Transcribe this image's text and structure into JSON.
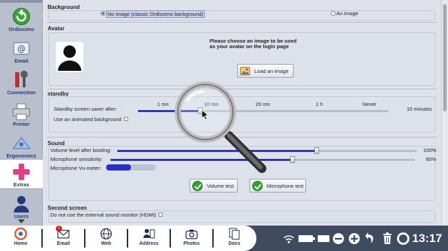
{
  "sidebar": {
    "items": [
      {
        "label": "Ordissimo",
        "icon": "back-arrow-icon"
      },
      {
        "label": "Email",
        "icon": "email-icon"
      },
      {
        "label": "Connection",
        "icon": "connection-tools-icon"
      },
      {
        "label": "Printer",
        "icon": "printer-icon"
      },
      {
        "label": "Ergonomics",
        "icon": "ergonomics-icon"
      },
      {
        "label": "Extras",
        "icon": "plus-icon"
      },
      {
        "label": "Users",
        "icon": "user-icon"
      }
    ]
  },
  "background": {
    "title": "Background",
    "option_no_image": "No image (classic Ordissimo background)",
    "option_image": "An image"
  },
  "avatar": {
    "title": "Avatar",
    "prompt_line1": "Please choose an image to be used",
    "prompt_line2": "as your avatar on the login page",
    "load_button": "Load an image"
  },
  "standby": {
    "title": "standby",
    "saver_label": "Standby screen saver after:",
    "ticks": [
      "1 mn",
      "10 mn",
      "20 mn",
      "1 h",
      "Never"
    ],
    "value_text": "10 minutes",
    "level": 0.25,
    "animated_label": "Use an animated background"
  },
  "sound": {
    "title": "Sound",
    "volume_label": "Volume level after booting:",
    "volume_value": "100%",
    "volume_level": 1.0,
    "mic_label": "Microphone sensitivity:",
    "mic_value": "60%",
    "mic_level": 0.6,
    "vu_label": "Microphone Vu-meter:",
    "vu_level": 0.5,
    "volume_test": "Volume test",
    "mic_test": "Microphone test"
  },
  "second_screen": {
    "title": "Second screen",
    "hdmi_label": "Do not use the external sound monitor (HDMI)"
  },
  "taskbar": {
    "items": [
      {
        "label": "Home",
        "icon": "ordissimo-home-icon"
      },
      {
        "label": "Email",
        "icon": "email-icon",
        "badge": "1"
      },
      {
        "label": "Web",
        "icon": "globe-icon"
      },
      {
        "label": "Address",
        "icon": "address-book-icon"
      },
      {
        "label": "Photos",
        "icon": "camera-icon"
      },
      {
        "label": "Docs",
        "icon": "documents-icon"
      }
    ],
    "time": "13:17"
  },
  "colors": {
    "accent": "#2b35b5",
    "taskbar_bg": "#3f4b5e",
    "sidebar_bg": "#b9bfcd"
  }
}
